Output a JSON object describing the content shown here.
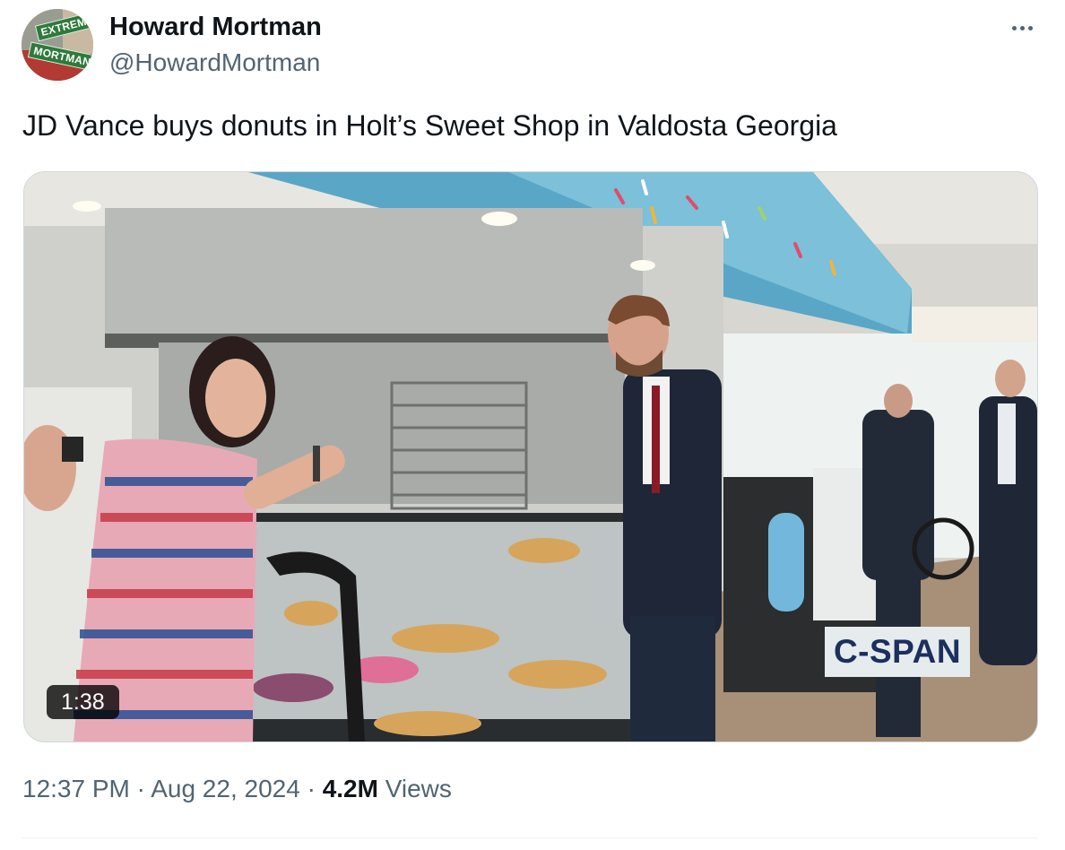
{
  "author": {
    "display_name": "Howard Mortman",
    "handle": "@HowardMortman",
    "avatar_sign_top": "EXTREME",
    "avatar_sign_bottom": "MORTMAN"
  },
  "tweet": {
    "text": "JD Vance buys donuts in Holt’s Sweet Shop in Valdosta Georgia"
  },
  "video": {
    "duration": "1:38",
    "watermark": "C-SPAN"
  },
  "meta": {
    "time": "12:37 PM",
    "separator": "·",
    "date": "Aug 22, 2024",
    "views_count": "4.2M",
    "views_label": "Views"
  },
  "icons": {
    "more": "more-options-icon"
  },
  "colors": {
    "text_primary": "#0f1419",
    "text_secondary": "#536471",
    "border": "#cfd9de"
  }
}
